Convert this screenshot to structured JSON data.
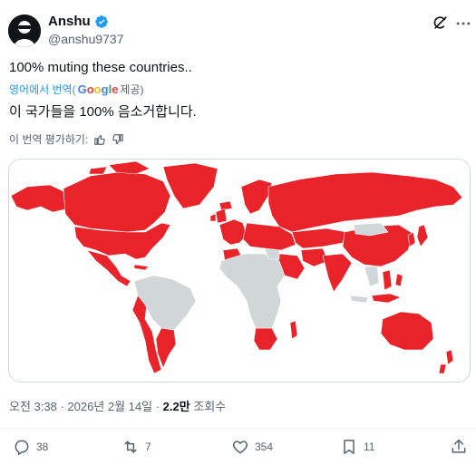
{
  "author": {
    "name": "Anshu",
    "handle": "@anshu9737",
    "verified_color": "#1d9bf0"
  },
  "tweet": {
    "text": "100% muting these countries..",
    "translate_prefix": "영어에서 번역(",
    "translate_brand": "Google",
    "translate_suffix": " 제공)",
    "translated_text": "이 국가들을 100% 음소거합니다.",
    "rate_label": "이 번역 평가하기:"
  },
  "meta": {
    "time": "오전 3:38 · 2026년 2월 14일 · ",
    "views_count": "2.2만",
    "views_label": " 조회수"
  },
  "actions": {
    "replies": "38",
    "reposts": "7",
    "likes": "354",
    "bookmarks": "11"
  },
  "map": {
    "highlight_color": "#e8232a",
    "other_color": "#d1d6d8",
    "ocean_color": "#ffffff"
  }
}
